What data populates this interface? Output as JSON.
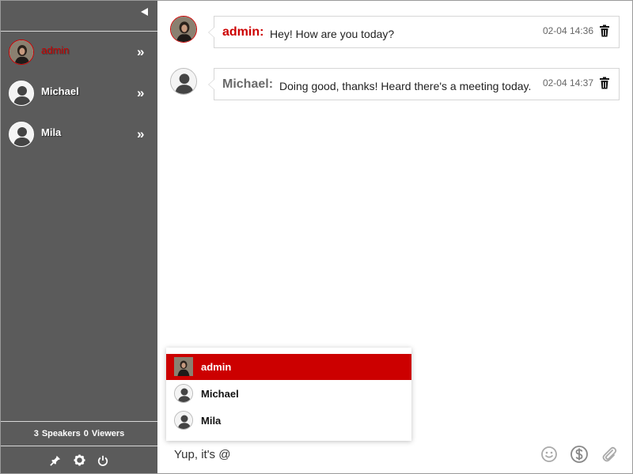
{
  "sidebar": {
    "users": [
      {
        "name": "admin",
        "chevron": "»",
        "active": true
      },
      {
        "name": "Michael",
        "chevron": "»",
        "active": false
      },
      {
        "name": "Mila",
        "chevron": "»",
        "active": false
      }
    ],
    "counts": {
      "speakers": "3",
      "speakers_label": "Speakers",
      "viewers": "0",
      "viewers_label": "Viewers"
    },
    "tool_icons": [
      "pin-icon",
      "gear-icon",
      "power-icon"
    ]
  },
  "messages": [
    {
      "sender": "admin:",
      "text": "Hey! How are you today?",
      "time": "02-04 14:36"
    },
    {
      "sender": "Michael:",
      "text": "Doing good, thanks! Heard there's a meeting today.",
      "time": "02-04 14:37"
    }
  ],
  "mention_popup": {
    "items": [
      {
        "name": "admin",
        "selected": true
      },
      {
        "name": "Michael",
        "selected": false
      },
      {
        "name": "Mila",
        "selected": false
      }
    ]
  },
  "composer": {
    "value": "Yup, it's @",
    "tool_icons": [
      "emoji-icon",
      "dollar-icon",
      "paperclip-icon"
    ]
  },
  "colors": {
    "accent": "#cc0000",
    "sidebar_bg": "#5b5b5b"
  }
}
